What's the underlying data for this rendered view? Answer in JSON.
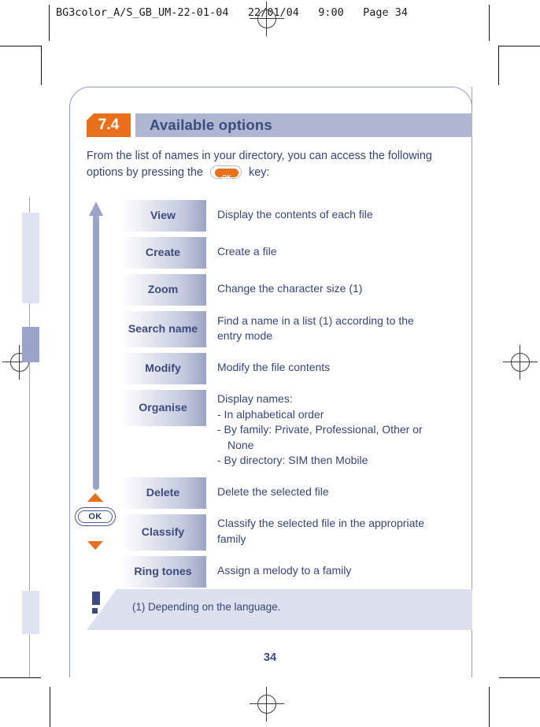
{
  "print_header": {
    "text": "BG3color_A/S_GB_UM-22-01-04   22/01/04   9:00   Page 34"
  },
  "section": {
    "number": "7.4",
    "title": "Available options",
    "number_bg": "#e8701a",
    "band_bg": "#aeb6d2"
  },
  "intro": {
    "line1": "From the list of names in your directory, you can access the following",
    "line2_before": "options by pressing the",
    "line2_after": "key:",
    "ok_key_label": "OK"
  },
  "options": [
    {
      "label": "View",
      "lines": [
        "Display the contents of each file"
      ],
      "justified": false
    },
    {
      "label": "Create",
      "lines": [
        "Create a file"
      ],
      "justified": false
    },
    {
      "label": "Zoom",
      "lines": [
        "Change the character size (1)"
      ],
      "justified": false
    },
    {
      "label": "Search name",
      "lines": [
        "Find  a  name  in  a  list  (1)  according  to  the",
        "entry mode"
      ],
      "justified": true
    },
    {
      "label": "Modify",
      "lines": [
        "Modify the file contents"
      ],
      "justified": false
    },
    {
      "label": "Organise",
      "lines": [
        "Display names:",
        "- In alphabetical order",
        "- By family: Private, Professional, Other or",
        "None",
        "- By directory: SIM then Mobile"
      ],
      "justified": false
    },
    {
      "label": "Delete",
      "lines": [
        "Delete the selected file"
      ],
      "justified": false
    },
    {
      "label": "Classify",
      "lines": [
        "Classify  the  selected  file  in  the  appropriate",
        "family"
      ],
      "justified": true
    },
    {
      "label": "Ring tones",
      "lines": [
        "Assign a melody to a family"
      ],
      "justified": false
    }
  ],
  "nav_pad": {
    "ok_label": "OK",
    "triangle_color": "#e8701a"
  },
  "footnote": {
    "marker": "(1)",
    "text": "Depending on the language.",
    "full": "(1)  Depending on the language."
  },
  "page_number": "34",
  "colors": {
    "text_blue": "#36457c",
    "accent_orange": "#e8701a",
    "band_light": "#dde1ee",
    "arrow_blue": "#9aa4c8"
  }
}
